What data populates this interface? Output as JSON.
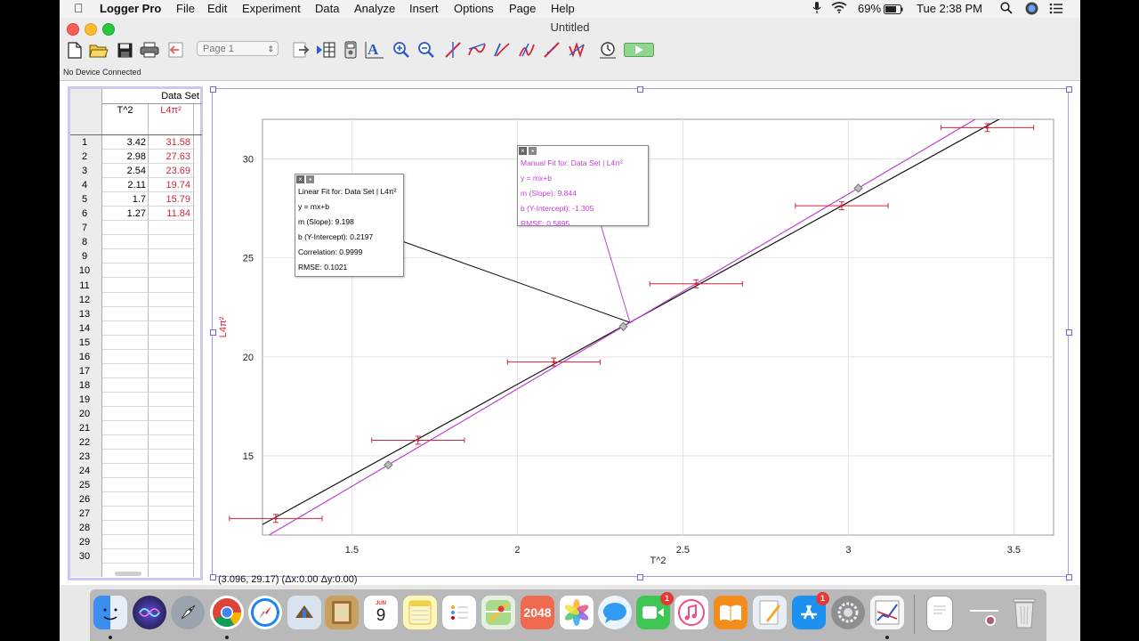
{
  "menubar": {
    "app_name": "Logger Pro",
    "menus": [
      "File",
      "Edit",
      "Experiment",
      "Data",
      "Analyze",
      "Insert",
      "Options",
      "Page",
      "Help"
    ],
    "battery": "69%",
    "clock": "Tue 2:38 PM"
  },
  "window": {
    "title": "Untitled",
    "page_selector": "Page 1",
    "status": "No Device Connected"
  },
  "table": {
    "dataset_title": "Data Set",
    "col1_header": "T^2",
    "col2_header": "L4π²",
    "row_numbers": [
      "1",
      "2",
      "3",
      "4",
      "5",
      "6",
      "7",
      "8",
      "9",
      "10",
      "11",
      "12",
      "13",
      "14",
      "15",
      "16",
      "17",
      "18",
      "19",
      "20",
      "21",
      "22",
      "23",
      "24",
      "25",
      "26",
      "27",
      "28",
      "29",
      "30"
    ],
    "col1": [
      "3.42",
      "2.98",
      "2.54",
      "2.11",
      "1.7",
      "1.27"
    ],
    "col2": [
      "31.58",
      "27.63",
      "23.69",
      "19.74",
      "15.79",
      "11.84"
    ]
  },
  "graph": {
    "readout": "(3.096, 29.17) (Δx:0.00 Δy:0.00)",
    "linear_fit": {
      "title": "Linear Fit for: Data Set | L4π²",
      "equation": "y = mx+b",
      "slope": "m (Slope): 9.198",
      "intercept": "b (Y-Intercept): 0.2197",
      "correlation": "Correlation: 0.9999",
      "rmse": "RMSE: 0.1021"
    },
    "manual_fit": {
      "title": "Manual Fit for: Data Set | L4π²",
      "equation": "y = mx+b",
      "slope": "m (Slope): 9.844",
      "intercept": "b (Y-Intercept): -1.305",
      "rmse": "RMSE: 0.5895"
    },
    "colors": {
      "data": "#d2253a",
      "manual_fit": "#c040d0",
      "linear_fit": "#111111"
    }
  },
  "chart_data": {
    "type": "scatter",
    "xlabel": "T^2",
    "ylabel": "L4π²",
    "xlim": [
      1.23,
      3.62
    ],
    "ylim": [
      11.0,
      32.0
    ],
    "x_ticks": [
      "1.5",
      "2",
      "2.5",
      "3",
      "3.5"
    ],
    "y_ticks": [
      "15",
      "20",
      "25",
      "30"
    ],
    "grid": true,
    "series": [
      {
        "name": "L4π²",
        "x": [
          3.42,
          2.98,
          2.54,
          2.11,
          1.7,
          1.27
        ],
        "y": [
          31.58,
          27.63,
          23.69,
          19.74,
          15.79,
          11.84
        ],
        "x_error": 0.14,
        "y_error": 0.2
      }
    ],
    "fits": [
      {
        "name": "Linear Fit",
        "slope": 9.198,
        "intercept": 0.2197
      },
      {
        "name": "Manual Fit",
        "slope": 9.844,
        "intercept": -1.305
      }
    ]
  },
  "dock": {
    "calendar_month": "JUN",
    "calendar_day": "9",
    "game_label": "2048",
    "facetime_badge": "1",
    "appstore_badge": "1"
  }
}
